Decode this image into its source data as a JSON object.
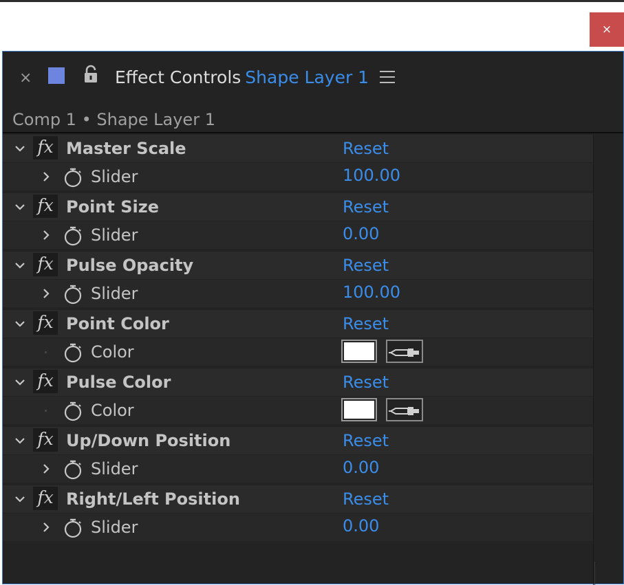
{
  "window": {
    "close_glyph": "×",
    "close_color": "#c94c4c"
  },
  "panel": {
    "close_glyph": "×",
    "label_color": "#6e85e0",
    "title": "Effect Controls",
    "layer_name": "Shape Layer 1",
    "breadcrumb": "Comp 1 • Shape Layer 1",
    "accent_color": "#3b8dea",
    "icons": [
      "close-icon",
      "lock-icon",
      "hamburger-menu-icon",
      "chevron-down-icon",
      "chevron-right-icon",
      "fx-icon",
      "stopwatch-icon",
      "eyedropper-icon"
    ]
  },
  "effects": [
    {
      "name": "Master Scale",
      "reset": "Reset",
      "fx": "fx",
      "property": {
        "name": "Slider",
        "type": "slider",
        "value": "100.00"
      }
    },
    {
      "name": "Point Size",
      "reset": "Reset",
      "fx": "fx",
      "property": {
        "name": "Slider",
        "type": "slider",
        "value": "0.00"
      }
    },
    {
      "name": "Pulse Opacity",
      "reset": "Reset",
      "fx": "fx",
      "property": {
        "name": "Slider",
        "type": "slider",
        "value": "100.00"
      }
    },
    {
      "name": "Point Color",
      "reset": "Reset",
      "fx": "fx",
      "property": {
        "name": "Color",
        "type": "color",
        "color": "#ffffff"
      }
    },
    {
      "name": "Pulse Color",
      "reset": "Reset",
      "fx": "fx",
      "property": {
        "name": "Color",
        "type": "color",
        "color": "#ffffff"
      }
    },
    {
      "name": "Up/Down Position",
      "reset": "Reset",
      "fx": "fx",
      "property": {
        "name": "Slider",
        "type": "slider",
        "value": "0.00"
      }
    },
    {
      "name": "Right/Left Position",
      "reset": "Reset",
      "fx": "fx",
      "property": {
        "name": "Slider",
        "type": "slider",
        "value": "0.00"
      }
    }
  ]
}
